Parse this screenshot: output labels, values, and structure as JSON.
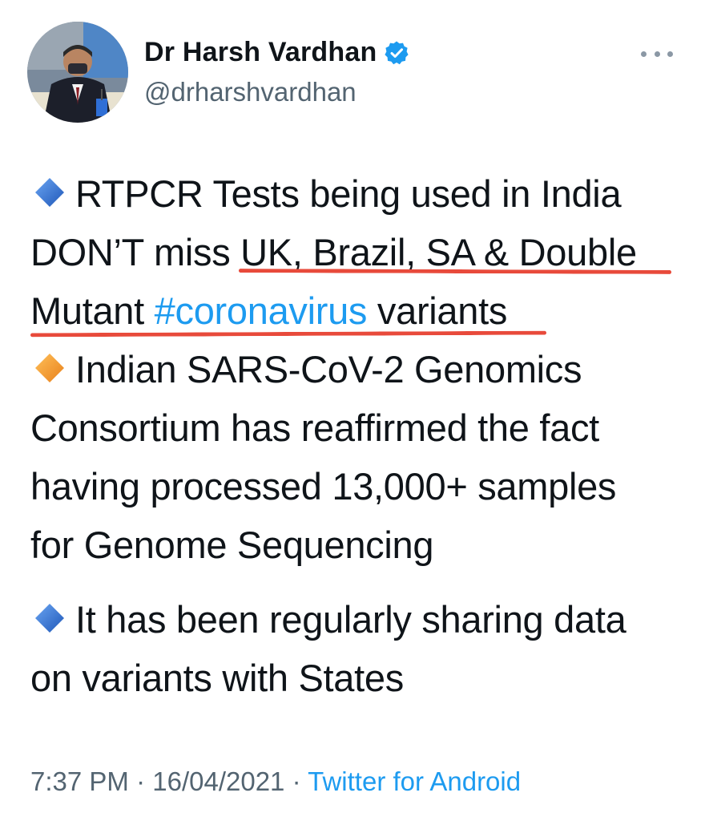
{
  "author": {
    "display_name": "Dr Harsh Vardhan",
    "handle": "@drharshvardhan",
    "verified": true,
    "avatar_icon": "profile-photo"
  },
  "tweet": {
    "lines": [
      {
        "bullet": "blue-diamond-icon",
        "text": "RTPCR Tests being used in India"
      },
      {
        "text": "DON’T miss UK, Brazil, SA & Double"
      },
      {
        "text_before": "Mutant ",
        "hashtag": "#coronavirus",
        "text_after": " variants"
      },
      {
        "bullet": "orange-diamond-icon",
        "text": "Indian SARS-CoV-2 Genomics"
      },
      {
        "text": "Consortium has reaffirmed the fact"
      },
      {
        "text": "having processed 13,000+ samples"
      },
      {
        "text": "for Genome Sequencing"
      },
      {
        "bullet": "blue-diamond-icon",
        "text": "It has been regularly sharing data"
      },
      {
        "text": "on variants with States"
      }
    ]
  },
  "meta": {
    "time": "7:37 PM",
    "separator": " · ",
    "date": "16/04/2021",
    "source": "Twitter for Android"
  },
  "colors": {
    "hashtag": "#1d9bf0",
    "underline": "#e84a3b",
    "blue_diamond": "#2f6fd6",
    "orange_diamond": "#f39c2c",
    "muted": "#536471"
  }
}
